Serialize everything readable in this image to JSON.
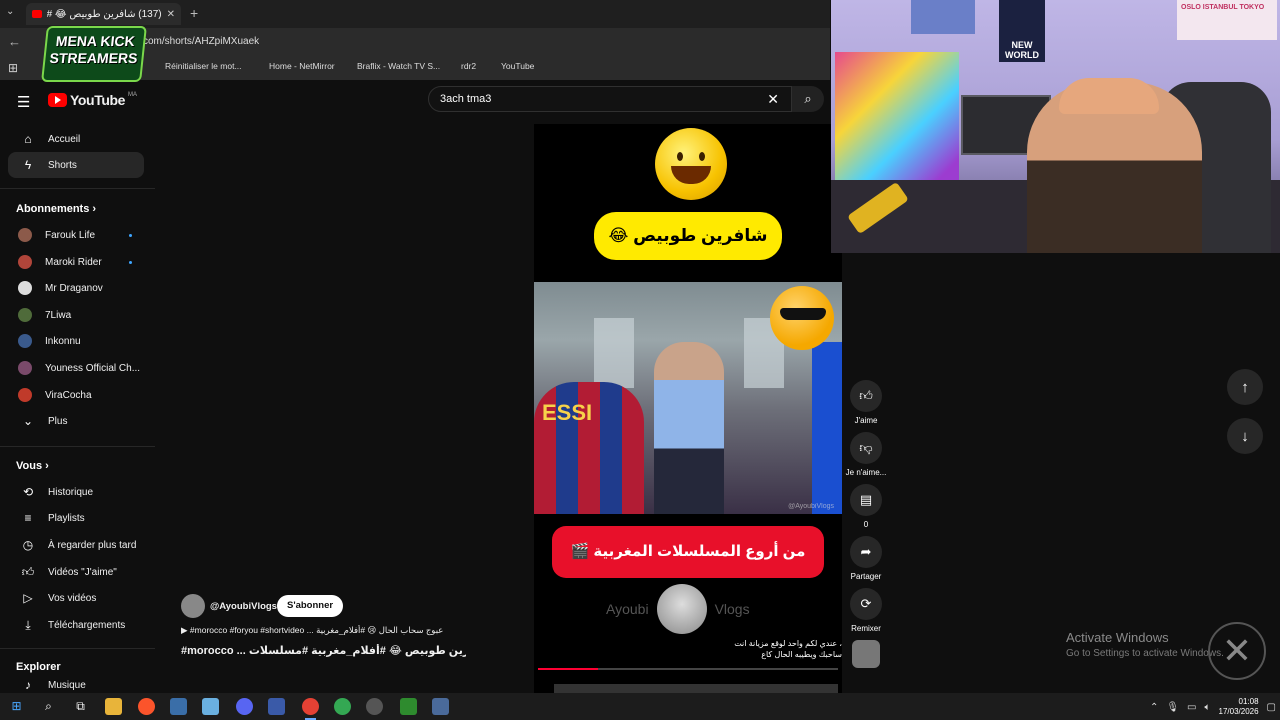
{
  "browser": {
    "tab_title": "(137) شافرين طوبيص 😂 #أف",
    "url": "com/shorts/AHZpiMXuaek",
    "bookmarks": [
      {
        "label": "Réinitialiser le mot...",
        "color": "#e1306c"
      },
      {
        "label": "Home - NetMirror",
        "color": "#e50914"
      },
      {
        "label": "Braflix - Watch TV S...",
        "color": "#e0552b"
      },
      {
        "label": "rdr2",
        "color": "#bbbbbb"
      },
      {
        "label": "YouTube",
        "color": "#ff0000"
      }
    ]
  },
  "overlay_logo": {
    "line1": "MENA KICK",
    "line2": "STREAMERS"
  },
  "youtube": {
    "logo_text": "YouTube",
    "country_code": "MA",
    "search_value": "3ach tma3"
  },
  "sidebar": {
    "main": [
      {
        "label": "Accueil",
        "icon": "home-icon"
      },
      {
        "label": "Shorts",
        "icon": "shorts-icon",
        "active": true
      }
    ],
    "subscriptions_title": "Abonnements",
    "subscriptions": [
      {
        "label": "Farouk Life",
        "color": "#8c5a4a",
        "new": true
      },
      {
        "label": "Maroki Rider",
        "color": "#b0453a",
        "new": true
      },
      {
        "label": "Mr Draganov",
        "color": "#dddddd"
      },
      {
        "label": "7Liwa",
        "color": "#4f6b3a"
      },
      {
        "label": "Inkonnu",
        "color": "#3a5a8c"
      },
      {
        "label": "Youness Official Ch...",
        "color": "#7a4a6a"
      },
      {
        "label": "ViraCocha",
        "color": "#c03a2a"
      },
      {
        "label": "Plus",
        "color": ""
      }
    ],
    "you_title": "Vous",
    "you_items": [
      {
        "label": "Historique",
        "icon": "history-icon"
      },
      {
        "label": "Playlists",
        "icon": "playlists-icon"
      },
      {
        "label": "À regarder plus tard",
        "icon": "watch-later-icon"
      },
      {
        "label": "Vidéos \"J'aime\"",
        "icon": "liked-videos-icon"
      },
      {
        "label": "Vos vidéos",
        "icon": "your-videos-icon"
      },
      {
        "label": "Téléchargements",
        "icon": "downloads-icon"
      }
    ],
    "explore_title": "Explorer",
    "explore_items": [
      {
        "label": "Musique",
        "icon": "music-icon"
      }
    ]
  },
  "short": {
    "top_banner": "شافرين طوبيص 😂",
    "bottom_banner": "من أروع المسلسلات المغربية 🎬",
    "watermark_left": "Ayoubi",
    "watermark_right": "Vlogs",
    "photo_watermark": "@AyoubiVlogs",
    "caption_line1": "، عندي لكم واحد لوقع مزيانة انت",
    "caption_line2": "ساحبك ويطيبه الحال كاع",
    "progress_fraction": 0.2,
    "channel_handle": "@AyoubiVlogs",
    "subscribe_label": "S'abonner",
    "description": "#morocco #foryou #shortvideo ... عبوج سحاب الحال 😢 #أفلام_مغربية",
    "title": "#morocco ... شافرين طوبيص 😂 #أفلام_مغربية #مسلسلات"
  },
  "actions": {
    "like_label": "J'aime",
    "dislike_label": "Je n'aime...",
    "comments_count": "0",
    "share_label": "Partager",
    "remix_label": "Remixer"
  },
  "webcam": {
    "poster_text": "NEW WORLD",
    "banner_text": "OSLO ISTANBUL TOKYO"
  },
  "windows": {
    "activate_title": "Activate Windows",
    "activate_sub": "Go to Settings to activate Windows.",
    "time": "01:08",
    "date": "17/03/2026"
  }
}
